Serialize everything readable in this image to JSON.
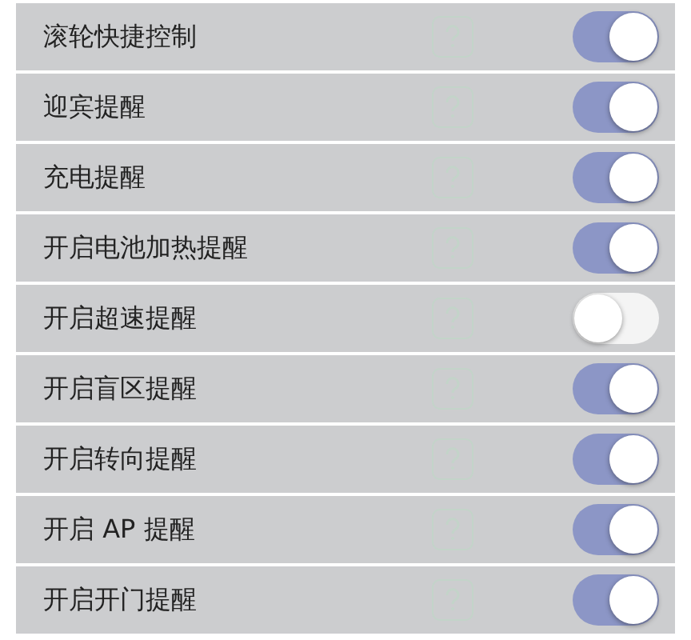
{
  "settings": [
    {
      "label": "滚轮快捷控制",
      "on": true
    },
    {
      "label": "迎宾提醒",
      "on": true
    },
    {
      "label": "充电提醒",
      "on": true
    },
    {
      "label": "开启电池加热提醒",
      "on": true
    },
    {
      "label": "开启超速提醒",
      "on": false
    },
    {
      "label": "开启盲区提醒",
      "on": true
    },
    {
      "label": "开启转向提醒",
      "on": true
    },
    {
      "label": "开启 AP 提醒",
      "on": true
    },
    {
      "label": "开启开门提醒",
      "on": true
    }
  ]
}
